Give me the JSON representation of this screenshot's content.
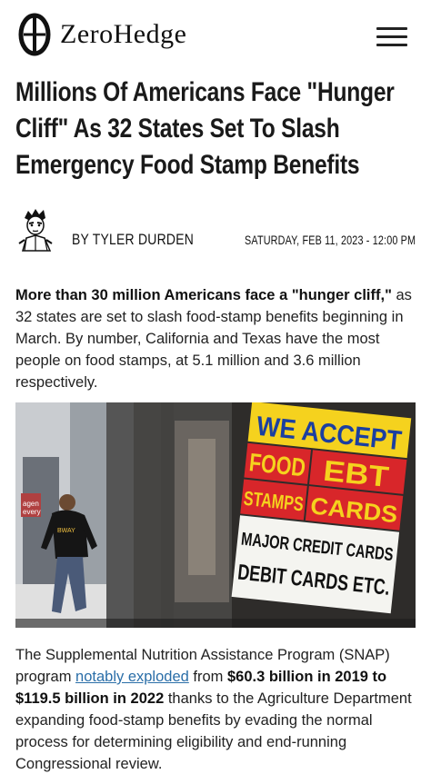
{
  "site": {
    "brand": "ZeroHedge",
    "menu_icon": "hamburger-menu-icon"
  },
  "article": {
    "title": "Millions Of Americans Face \"Hunger Cliff\" As 32 States Set To Slash Emergency Food Stamp Benefits",
    "author": "BY TYLER DURDEN",
    "date": "SATURDAY, FEB 11, 2023 - 12:00 PM",
    "lead_bold": "More than 30 million Americans face a \"hunger cliff,\"",
    "lead_rest": " as 32 states are set to slash food-stamp benefits beginning in March. By number, California and Texas have the most people on food stamps, at 5.1 million and 3.6 million respectively.",
    "image_sign": {
      "line1": "WE ACCEPT",
      "line2a": "FOOD",
      "line2b": "EBT",
      "line3a": "STAMPS",
      "line3b": "CARDS",
      "line4": "MAJOR CREDIT CARDS",
      "line5": "DEBIT CARDS ETC.",
      "shirt": "BWAY"
    },
    "para2_start": "The Supplemental Nutrition Assistance Program (SNAP) program ",
    "para2_link": "notably exploded",
    "para2_mid": " from ",
    "para2_bold": "$60.3 billion in 2019 to $119.5 billion in 2022",
    "para2_end": " thanks to the Agriculture Department expanding food-stamp benefits by evading the normal process for determining eligibility and end-running Congressional review."
  },
  "colors": {
    "link": "#2a6ea8",
    "sign_red": "#d8262a",
    "sign_yellow": "#f5d21e"
  }
}
